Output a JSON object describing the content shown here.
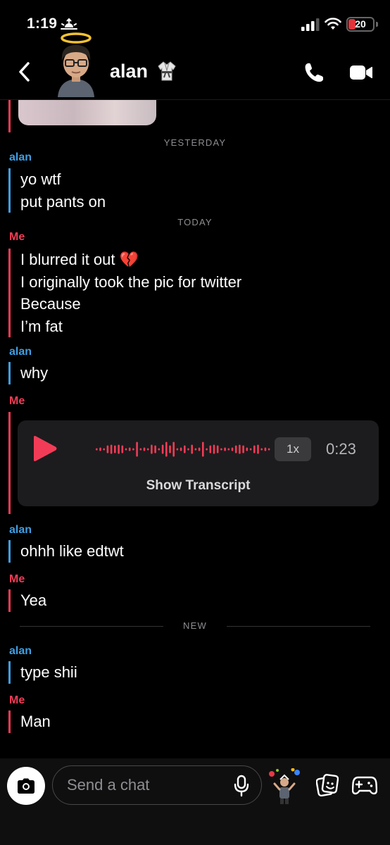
{
  "status_bar": {
    "time": "1:19",
    "battery": "20",
    "icons": [
      "sun-horizon-icon",
      "signal-bars-icon",
      "wifi-icon",
      "battery-icon"
    ]
  },
  "header": {
    "contact_name": "alan",
    "icons": [
      "back-chevron-icon",
      "halo-avatar",
      "karate-uniform-icon",
      "phone-icon",
      "video-camera-icon"
    ]
  },
  "chat": {
    "date_yesterday": "YESTERDAY",
    "date_today": "TODAY",
    "new_label": "NEW",
    "groups": [
      {
        "sender": "alan",
        "messages": [
          "yo wtf",
          "put pants on"
        ]
      },
      {
        "sender": "Me",
        "messages": [
          "I blurred it out 💔",
          "I originally took the pic for twitter",
          "Because",
          "I’m fat"
        ]
      },
      {
        "sender": "alan",
        "messages": [
          "why"
        ]
      },
      {
        "sender": "Me",
        "voice_note": {
          "speed": "1x",
          "duration": "0:23",
          "transcript_label": "Show Transcript"
        }
      },
      {
        "sender": "alan",
        "messages": [
          "ohhh like edtwt"
        ]
      },
      {
        "sender": "Me",
        "messages": [
          "Yea"
        ]
      },
      {
        "sender": "alan",
        "messages": [
          "type shii"
        ]
      },
      {
        "sender": "Me",
        "messages": [
          "Man"
        ]
      }
    ]
  },
  "composer": {
    "placeholder": "Send a chat",
    "icons": [
      "camera-icon",
      "mic-icon",
      "bitmoji-icon",
      "sticker-icon",
      "game-controller-icon"
    ]
  },
  "colors": {
    "alan": "#3e9fe3",
    "me": "#f23c57",
    "background": "#000000",
    "card": "#1c1c1e"
  }
}
